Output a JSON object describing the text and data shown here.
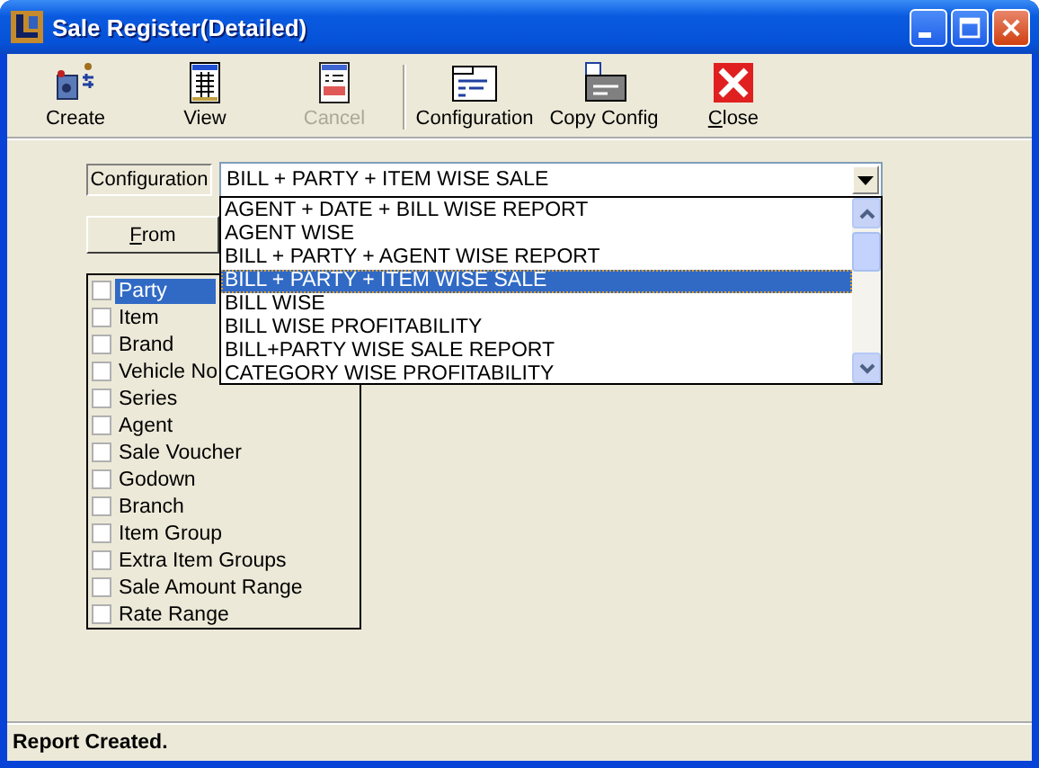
{
  "window": {
    "title": "Sale Register(Detailed)"
  },
  "toolbar": [
    {
      "kind": "create",
      "label": "Create",
      "disabled": false
    },
    {
      "kind": "view",
      "label": "View",
      "disabled": false
    },
    {
      "kind": "cancel",
      "label": "Cancel",
      "disabled": true
    },
    {
      "kind": "configuration",
      "label": "Configuration",
      "disabled": false
    },
    {
      "kind": "copy",
      "label": "Copy Config",
      "disabled": false
    },
    {
      "kind": "close",
      "label": "Close",
      "disabled": false
    }
  ],
  "configuration": {
    "label": "Configuration",
    "value": "BILL + PARTY + ITEM WISE SALE",
    "options": [
      {
        "label": "AGENT + DATE + BILL WISE REPORT",
        "selected": false
      },
      {
        "label": "AGENT WISE",
        "selected": false
      },
      {
        "label": "BILL + PARTY + AGENT WISE REPORT",
        "selected": false
      },
      {
        "label": "BILL + PARTY + ITEM WISE SALE",
        "selected": true
      },
      {
        "label": "BILL WISE",
        "selected": false
      },
      {
        "label": "BILL WISE PROFITABILITY",
        "selected": false
      },
      {
        "label": "BILL+PARTY WISE SALE REPORT",
        "selected": false
      },
      {
        "label": "CATEGORY WISE PROFITABILITY",
        "selected": false
      }
    ]
  },
  "from_button": "From",
  "fields": [
    {
      "label": "Party",
      "checked": false,
      "selected": true
    },
    {
      "label": "Item",
      "checked": false,
      "selected": false
    },
    {
      "label": "Brand",
      "checked": false,
      "selected": false
    },
    {
      "label": "Vehicle No",
      "checked": false,
      "selected": false
    },
    {
      "label": "Series",
      "checked": false,
      "selected": false
    },
    {
      "label": "Agent",
      "checked": false,
      "selected": false
    },
    {
      "label": "Sale Voucher",
      "checked": false,
      "selected": false
    },
    {
      "label": "Godown",
      "checked": false,
      "selected": false
    },
    {
      "label": "Branch",
      "checked": false,
      "selected": false
    },
    {
      "label": "Item Group",
      "checked": false,
      "selected": false
    },
    {
      "label": "Extra Item Groups",
      "checked": false,
      "selected": false
    },
    {
      "label": "Sale Amount Range",
      "checked": false,
      "selected": false
    },
    {
      "label": "Rate Range",
      "checked": false,
      "selected": false
    }
  ],
  "status_bar": "Report Created."
}
